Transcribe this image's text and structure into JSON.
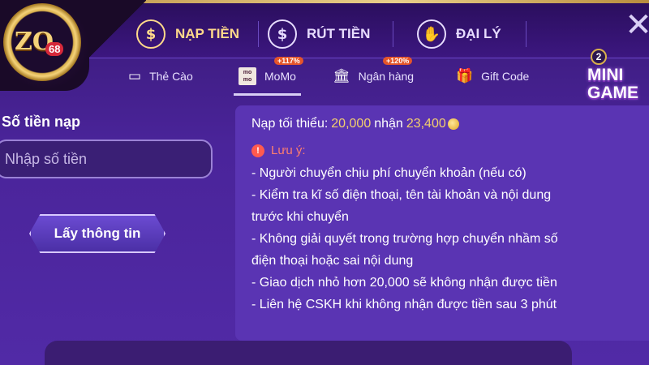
{
  "brand": {
    "logo_text": "ZO",
    "logo_badge": "68"
  },
  "main_tabs": [
    {
      "label": "NẠP TIỀN",
      "icon": "dollar-circle-icon",
      "active": true
    },
    {
      "label": "RÚT TIỀN",
      "icon": "withdraw-icon",
      "active": false
    },
    {
      "label": "ĐẠI LÝ",
      "icon": "handshake-icon",
      "active": false
    }
  ],
  "sub_tabs": [
    {
      "label": "Thẻ Cào",
      "icon": "card-icon"
    },
    {
      "label": "MoMo",
      "icon": "momo-icon",
      "bonus": "+117%",
      "active": true,
      "icon_text": "mo mo"
    },
    {
      "label": "Ngân hàng",
      "icon": "bank-icon",
      "bonus": "+120%"
    },
    {
      "label": "Gift Code",
      "icon": "gift-icon"
    }
  ],
  "mini_game": {
    "count": "2",
    "label": "MINI GAME"
  },
  "form": {
    "amount_label": "Số tiền nạp",
    "amount_placeholder": "Nhập số tiền",
    "get_info_button": "Lấy thông tin"
  },
  "info": {
    "min_prefix": "Nạp tối thiểu:",
    "min_amount": "20,000",
    "receive_label": "nhận",
    "receive_amount": "23,400",
    "note_title": "Lưu ý:",
    "notes": [
      "- Người chuyển chịu phí chuyển khoản (nếu có)",
      "- Kiểm tra kĩ số điện thoại, tên tài khoản và nội dung",
      "trước khi chuyển",
      "- Không giải quyết trong trường hợp chuyển nhầm số",
      "điện thoại hoặc sai nội dung",
      "- Giao dịch nhỏ hơn 20,000 sẽ không nhận được tiền",
      "- Liên hệ CSKH khi không nhận được tiền sau 3 phút"
    ]
  },
  "colors": {
    "accent_gold": "#f3cf6e",
    "warning": "#ff7f6e",
    "panel": "#5a34b3",
    "background": "#4a249a"
  }
}
